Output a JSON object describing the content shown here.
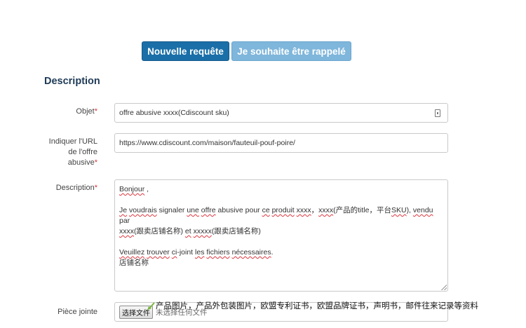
{
  "buttons": {
    "new_request": "Nouvelle requête",
    "callback": "Je souhaite être rappelé"
  },
  "section": {
    "title": "Description"
  },
  "form": {
    "objet": {
      "label": "Objet",
      "required_mark": "*",
      "value": "offre abusive xxxx(Cdiscount sku)"
    },
    "url": {
      "label_line1": "Indiquer l'URL",
      "label_line2": "de l'offre",
      "label_line3": "abusive",
      "required_mark": "*",
      "value": "https://www.cdiscount.com/maison/fauteuil-pouf-poire/"
    },
    "description": {
      "label": "Description",
      "required_mark": "*",
      "line1_word1": "Bonjour",
      "line1_rest": " ,",
      "line2_w1": "Je",
      "line2_w2": "voudrais",
      "line2_t1": " signaler ",
      "line2_w3": "une",
      "line2_w4": "offre",
      "line2_t2": " abusive pour ",
      "line2_w5": "ce",
      "line2_w6": "produit",
      "line2_w7": "xxxx",
      "line2_t3": "，",
      "line2_w8": "xxxx",
      "line2_t4": "(产品的title，平台",
      "line2_w9": "SKU",
      "line2_t5": "), ",
      "line2_w10": "vendu",
      "line2_t6": " par",
      "line3_w1": "xxxx",
      "line3_t1": "(跟卖店铺名称) ",
      "line3_w2": "et",
      "line3_w3": "xxxxx",
      "line3_t2": "(跟卖店铺名称)",
      "line4_w1": "Veuillez",
      "line4_w2": "trouver",
      "line4_w3": "ci",
      "line4_t1": "-joint ",
      "line4_w4": "les",
      "line4_w5": "fichiers",
      "line4_w6": "nécessaires",
      "line4_t2": ".",
      "line5": "店铺名称"
    },
    "attachment": {
      "label": "Pièce jointe",
      "button": "选择文件",
      "status": "未选择任何文件"
    }
  },
  "annotation": {
    "text": "产品图片，产品外包装图片，欧盟专利证书，欧盟品牌证书，声明书，邮件往来记录等资料"
  },
  "colors": {
    "primary": "#1a6fa8",
    "secondary": "#7fb6db",
    "required": "#d9363e",
    "heading": "#1f3b57"
  }
}
